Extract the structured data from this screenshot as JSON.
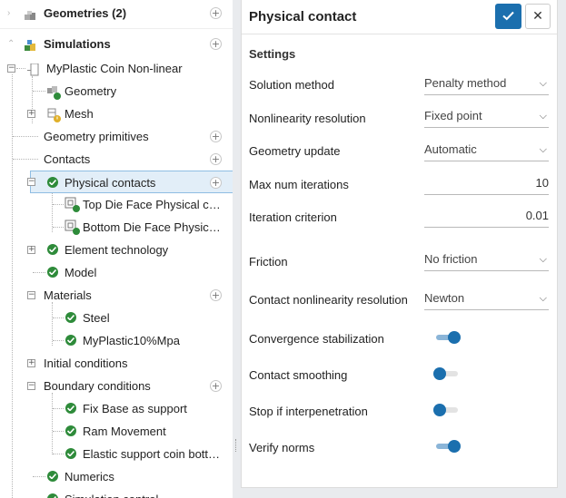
{
  "tree": {
    "items": [
      {
        "label": "Geometries (2)"
      },
      {
        "label": "Simulations"
      },
      {
        "label": "MyPlastic Coin Non-linear"
      },
      {
        "label": "Geometry"
      },
      {
        "label": "Mesh"
      },
      {
        "label": "Geometry primitives"
      },
      {
        "label": "Contacts"
      },
      {
        "label": "Physical contacts"
      },
      {
        "label": "Top Die Face Physical con..."
      },
      {
        "label": "Bottom Die Face Physical..."
      },
      {
        "label": "Element technology"
      },
      {
        "label": "Model"
      },
      {
        "label": "Materials"
      },
      {
        "label": "Steel"
      },
      {
        "label": "MyPlastic10%Mpa"
      },
      {
        "label": "Initial conditions"
      },
      {
        "label": "Boundary conditions"
      },
      {
        "label": "Fix Base as support"
      },
      {
        "label": "Ram Movement"
      },
      {
        "label": "Elastic support coin botto..."
      },
      {
        "label": "Numerics"
      },
      {
        "label": "Simulation control"
      }
    ]
  },
  "panel": {
    "title": "Physical contact",
    "section": "Settings",
    "fields": {
      "solution_method": {
        "label": "Solution method",
        "value": "Penalty method"
      },
      "nonlinearity_resolution": {
        "label": "Nonlinearity resolution",
        "value": "Fixed point"
      },
      "geometry_update": {
        "label": "Geometry update",
        "value": "Automatic"
      },
      "max_iterations": {
        "label": "Max num iterations",
        "value": "10"
      },
      "iteration_criterion": {
        "label": "Iteration criterion",
        "value": "0.01"
      },
      "friction": {
        "label": "Friction",
        "value": "No friction"
      },
      "contact_nonlinearity": {
        "label": "Contact nonlinearity resolution",
        "value": "Newton"
      }
    },
    "toggles": {
      "convergence_stabilization": {
        "label": "Convergence stabilization",
        "on": true
      },
      "contact_smoothing": {
        "label": "Contact smoothing",
        "on": false
      },
      "stop_interpenetration": {
        "label": "Stop if interpenetration",
        "on": false
      },
      "verify_norms": {
        "label": "Verify norms",
        "on": true
      }
    }
  },
  "colors": {
    "accent": "#1b6fae",
    "success": "#2e8b3a",
    "selected_bg": "#e2eef8"
  }
}
